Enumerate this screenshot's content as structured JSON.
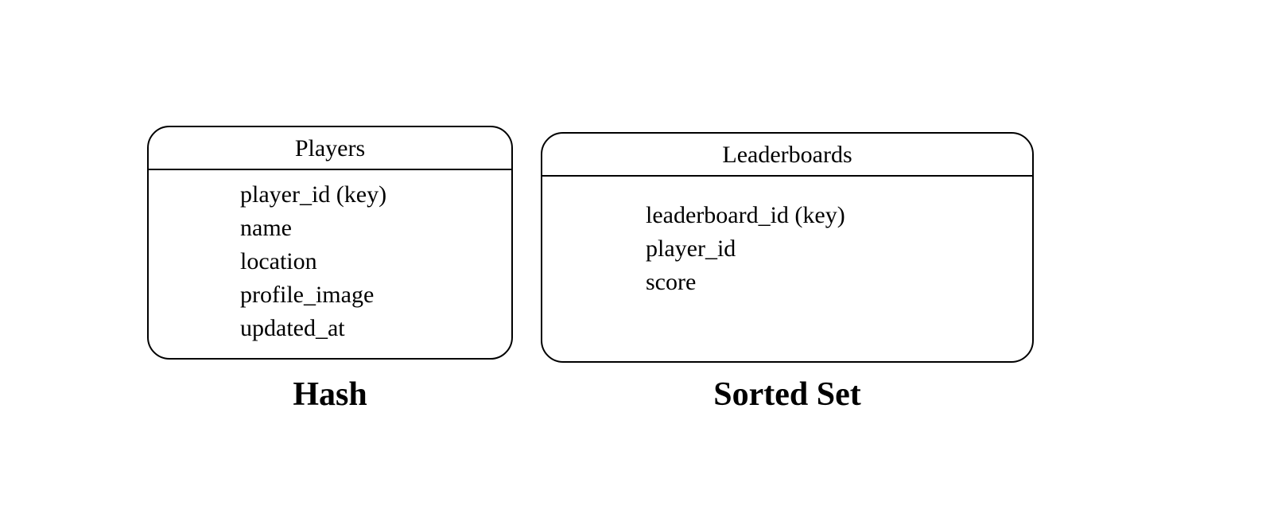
{
  "boxes": {
    "players": {
      "title": "Players",
      "fields": [
        "player_id (key)",
        "name",
        "location",
        "profile_image",
        "updated_at"
      ],
      "caption": "Hash"
    },
    "leaderboards": {
      "title": "Leaderboards",
      "fields": [
        "leaderboard_id (key)",
        "player_id",
        "score"
      ],
      "caption": "Sorted Set"
    }
  }
}
